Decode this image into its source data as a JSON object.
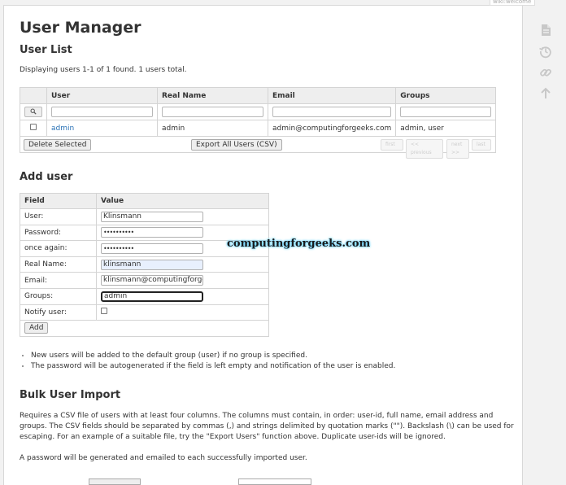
{
  "wiki_tag": "wiki:welcome",
  "side_tools": [
    "page-icon",
    "history-icon",
    "backlink-icon",
    "back-to-top-icon"
  ],
  "title": "User Manager",
  "user_list": {
    "heading": "User List",
    "summary": "Displaying users 1-1 of 1 found. 1 users total.",
    "columns": [
      "User",
      "Real Name",
      "Email",
      "Groups"
    ],
    "rows": [
      {
        "user": "admin",
        "real_name": "admin",
        "email": "admin@computingforgeeks.com",
        "groups": "admin, user"
      }
    ],
    "delete_button": "Delete Selected",
    "export_button": "Export All Users (CSV)",
    "pager": [
      "first",
      "<< previous",
      "next >>",
      "last"
    ]
  },
  "add_user": {
    "heading": "Add user",
    "columns": [
      "Field",
      "Value"
    ],
    "fields": {
      "user_label": "User:",
      "user_value": "Klinsmann",
      "password_label": "Password:",
      "password_value": "••••••••••",
      "again_label": "once again:",
      "again_value": "••••••••••",
      "realname_label": "Real Name:",
      "realname_value": "klinsmann",
      "email_label": "Email:",
      "email_value": "klinsmann@computingforgee",
      "groups_label": "Groups:",
      "groups_value": "admin",
      "notify_label": "Notify user:"
    },
    "add_button": "Add",
    "notes": [
      "New users will be added to the default group (user) if no group is specified.",
      "The password will be autogenerated if the field is left empty and notification of the user is enabled."
    ]
  },
  "watermark": "computingforgeeks.com",
  "bulk_import": {
    "heading": "Bulk User Import",
    "text1": "Requires a CSV file of users with at least four columns. The columns must contain, in order: user-id, full name, email address and groups. The CSV fields should be separated by commas (,) and strings delimited by quotation marks (\"\"). Backslash (\\) can be used for escaping. For an example of a suitable file, try the \"Export Users\" function above. Duplicate user-ids will be ignored.",
    "text2": "A password will be generated and emailed to each successfully imported user."
  },
  "colors": {
    "link": "#2b73b7",
    "header_bg": "#eeeeee",
    "page_bg": "#f2f2f2",
    "autofill": "#e8f0fe"
  }
}
